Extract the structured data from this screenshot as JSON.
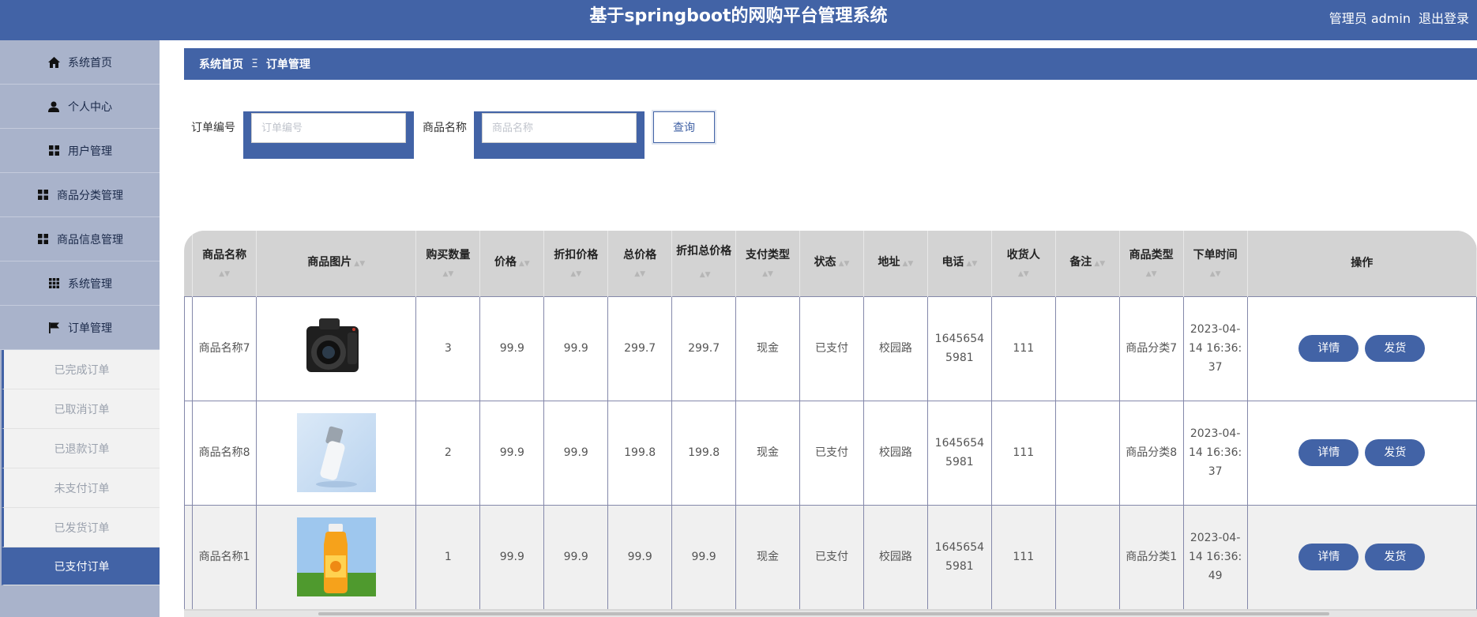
{
  "header": {
    "title": "基于springboot的网购平台管理系统",
    "user_label": "管理员 admin",
    "logout": "退出登录"
  },
  "sidebar": {
    "items": [
      {
        "label": "系统首页",
        "icon": "home-icon"
      },
      {
        "label": "个人中心",
        "icon": "person-icon"
      },
      {
        "label": "用户管理",
        "icon": "grid-icon"
      },
      {
        "label": "商品分类管理",
        "icon": "grid-icon"
      },
      {
        "label": "商品信息管理",
        "icon": "grid-icon"
      },
      {
        "label": "系统管理",
        "icon": "apps-icon"
      },
      {
        "label": "订单管理",
        "icon": "flag-icon"
      }
    ],
    "sub_items": [
      {
        "label": "已完成订单"
      },
      {
        "label": "已取消订单"
      },
      {
        "label": "已退款订单"
      },
      {
        "label": "未支付订单"
      },
      {
        "label": "已发货订单"
      },
      {
        "label": "已支付订单",
        "active": true
      }
    ]
  },
  "breadcrumb": {
    "home": "系统首页",
    "separator": "Ξ",
    "current": "订单管理"
  },
  "search": {
    "order_no_label": "订单编号",
    "order_no_placeholder": "订单编号",
    "order_no_value": "",
    "product_label": "商品名称",
    "product_placeholder": "商品名称",
    "product_value": "",
    "query_button": "查询"
  },
  "table": {
    "columns": [
      "商品名称",
      "商品图片",
      "购买数量",
      "价格",
      "折扣价格",
      "总价格",
      "折扣总价格",
      "支付类型",
      "状态",
      "地址",
      "电话",
      "收货人",
      "备注",
      "商品类型",
      "下单时间",
      "操作"
    ],
    "rows": [
      {
        "name": "商品名称7",
        "image": "camera",
        "qty": "3",
        "price": "99.9",
        "discount_price": "99.9",
        "total": "299.7",
        "discount_total": "299.7",
        "pay_type": "现金",
        "status": "已支付",
        "address": "校园路",
        "phone": "16456545981",
        "receiver": "111",
        "remark": "",
        "category": "商品分类7",
        "time": "2023-04-14 16:36:37"
      },
      {
        "name": "商品名称8",
        "image": "bottle",
        "qty": "2",
        "price": "99.9",
        "discount_price": "99.9",
        "total": "199.8",
        "discount_total": "199.8",
        "pay_type": "现金",
        "status": "已支付",
        "address": "校园路",
        "phone": "16456545981",
        "receiver": "111",
        "remark": "",
        "category": "商品分类8",
        "time": "2023-04-14 16:36:37"
      },
      {
        "name": "商品名称1",
        "image": "juice",
        "qty": "1",
        "price": "99.9",
        "discount_price": "99.9",
        "total": "99.9",
        "discount_total": "99.9",
        "pay_type": "现金",
        "status": "已支付",
        "address": "校园路",
        "phone": "16456545981",
        "receiver": "111",
        "remark": "",
        "category": "商品分类1",
        "time": "2023-04-14 16:36:49"
      }
    ],
    "actions": {
      "detail": "详情",
      "ship": "发货"
    }
  },
  "colors": {
    "primary": "#4263a6",
    "sidebar": "#a9b3cb",
    "header_cell": "#d3d3d3"
  }
}
